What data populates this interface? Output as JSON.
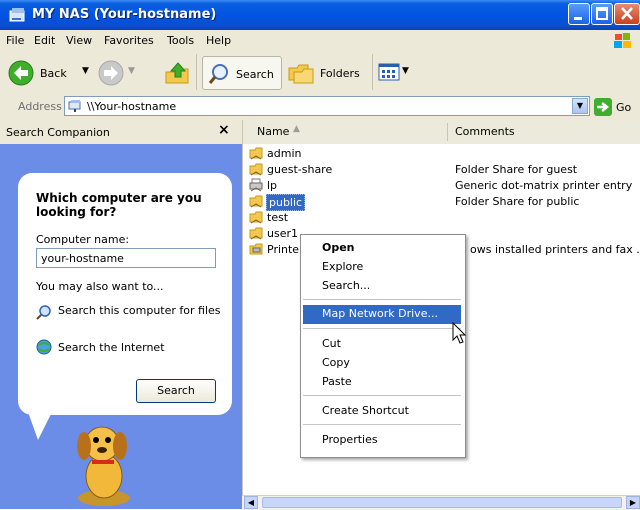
{
  "window": {
    "title": "MY NAS (Your-hostname)"
  },
  "menu": [
    "File",
    "Edit",
    "View",
    "Favorites",
    "Tools",
    "Help"
  ],
  "toolbar": {
    "back_label": "Back",
    "search_label": "Search",
    "folders_label": "Folders"
  },
  "address": {
    "label": "Address",
    "value": "\\\\Your-hostname",
    "go_label": "Go"
  },
  "search_companion": {
    "header": "Search Companion",
    "close_glyph": "×",
    "question": "Which computer are you looking for?",
    "computer_name_label": "Computer name:",
    "computer_name_value": "your-hostname",
    "also_label": "You may also want to...",
    "opt_search_computer": "Search this computer for files",
    "opt_search_internet": "Search the Internet",
    "search_button": "Search"
  },
  "columns": {
    "name": "Name",
    "comments": "Comments"
  },
  "files": [
    {
      "name": "admin",
      "comment": "",
      "icon": "shared-folder-icon"
    },
    {
      "name": "guest-share",
      "comment": "Folder Share for guest",
      "icon": "shared-folder-icon"
    },
    {
      "name": "lp",
      "comment": "Generic dot-matrix printer entry",
      "icon": "printer-icon"
    },
    {
      "name": "public",
      "comment": "Folder Share for public",
      "icon": "shared-folder-icon",
      "selected": true
    },
    {
      "name": "test",
      "comment": "",
      "icon": "shared-folder-icon"
    },
    {
      "name": "user1",
      "comment": "",
      "icon": "shared-folder-icon"
    },
    {
      "name": "Printe",
      "comment": "ows installed printers and fax ...",
      "icon": "printers-folder-icon"
    }
  ],
  "context_menu": [
    {
      "label": "Open",
      "bold": true
    },
    {
      "label": "Explore"
    },
    {
      "label": "Search..."
    },
    {
      "label": "Map Network Drive...",
      "highlighted": true
    },
    {
      "label": "Cut"
    },
    {
      "label": "Copy"
    },
    {
      "label": "Paste"
    },
    {
      "label": "Create Shortcut"
    },
    {
      "label": "Properties"
    }
  ],
  "colors": {
    "xp_blue": "#0054e3",
    "selection": "#316ac5",
    "pane_blue": "#6b8de8",
    "chrome": "#ece9d8"
  }
}
